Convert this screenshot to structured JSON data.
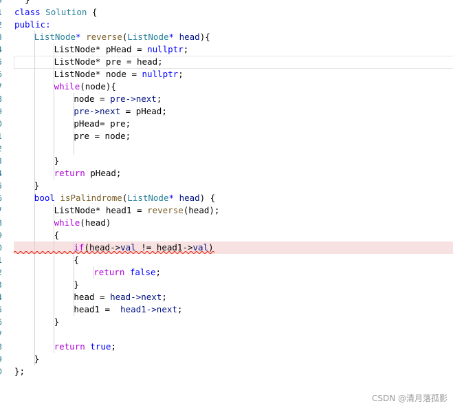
{
  "editor": {
    "lines": [
      {
        "num": "9",
        "indent": 0,
        "tokens": [
          {
            "t": "  }",
            "c": "plain"
          }
        ]
      },
      {
        "num": "1",
        "indent": 0,
        "tokens": [
          {
            "t": "class",
            "c": "kw"
          },
          {
            "t": " ",
            "c": "plain"
          },
          {
            "t": "Solution",
            "c": "type"
          },
          {
            "t": " {",
            "c": "plain"
          }
        ]
      },
      {
        "num": "2",
        "indent": 0,
        "tokens": [
          {
            "t": "public:",
            "c": "kw"
          }
        ]
      },
      {
        "num": "3",
        "indent": 1,
        "tokens": [
          {
            "t": "ListNode",
            "c": "type"
          },
          {
            "t": "* ",
            "c": "kw"
          },
          {
            "t": "reverse",
            "c": "fn"
          },
          {
            "t": "(",
            "c": "plain"
          },
          {
            "t": "ListNode",
            "c": "type"
          },
          {
            "t": "* ",
            "c": "kw"
          },
          {
            "t": "head",
            "c": "var"
          },
          {
            "t": "){",
            "c": "plain"
          }
        ]
      },
      {
        "num": "4",
        "indent": 2,
        "tokens": [
          {
            "t": "ListNode* pHead = ",
            "c": "plain"
          },
          {
            "t": "nullptr",
            "c": "kw"
          },
          {
            "t": ";",
            "c": "plain"
          }
        ]
      },
      {
        "num": "5",
        "indent": 2,
        "current": true,
        "tokens": [
          {
            "t": "ListNode* pre = head;",
            "c": "plain"
          }
        ]
      },
      {
        "num": "6",
        "indent": 2,
        "tokens": [
          {
            "t": "ListNode* node = ",
            "c": "plain"
          },
          {
            "t": "nullptr",
            "c": "kw"
          },
          {
            "t": ";",
            "c": "plain"
          }
        ]
      },
      {
        "num": "7",
        "indent": 2,
        "tokens": [
          {
            "t": "while",
            "c": "ctrl"
          },
          {
            "t": "(node){",
            "c": "plain"
          }
        ]
      },
      {
        "num": "8",
        "indent": 3,
        "tokens": [
          {
            "t": "node = ",
            "c": "plain"
          },
          {
            "t": "pre->next",
            "c": "var"
          },
          {
            "t": ";",
            "c": "plain"
          }
        ]
      },
      {
        "num": "9",
        "indent": 3,
        "tokens": [
          {
            "t": "pre->next",
            "c": "var"
          },
          {
            "t": " = pHead;",
            "c": "plain"
          }
        ]
      },
      {
        "num": "0",
        "indent": 3,
        "tokens": [
          {
            "t": "pHead= pre;",
            "c": "plain"
          }
        ]
      },
      {
        "num": "1",
        "indent": 3,
        "tokens": [
          {
            "t": "pre = node;",
            "c": "plain"
          }
        ]
      },
      {
        "num": "2",
        "indent": 3,
        "tokens": []
      },
      {
        "num": "3",
        "indent": 2,
        "tokens": [
          {
            "t": "}",
            "c": "plain"
          }
        ]
      },
      {
        "num": "4",
        "indent": 2,
        "tokens": [
          {
            "t": "return",
            "c": "ctrl"
          },
          {
            "t": " pHead;",
            "c": "plain"
          }
        ]
      },
      {
        "num": "5",
        "indent": 1,
        "tokens": [
          {
            "t": "}",
            "c": "plain"
          }
        ]
      },
      {
        "num": "6",
        "indent": 1,
        "tokens": [
          {
            "t": "bool",
            "c": "kw"
          },
          {
            "t": " ",
            "c": "plain"
          },
          {
            "t": "isPalindrome",
            "c": "fn"
          },
          {
            "t": "(",
            "c": "plain"
          },
          {
            "t": "ListNode",
            "c": "type"
          },
          {
            "t": "* ",
            "c": "kw"
          },
          {
            "t": "head",
            "c": "var"
          },
          {
            "t": ") {",
            "c": "plain"
          }
        ]
      },
      {
        "num": "7",
        "indent": 2,
        "tokens": [
          {
            "t": "ListNode* head1 = ",
            "c": "plain"
          },
          {
            "t": "reverse",
            "c": "fn"
          },
          {
            "t": "(head);",
            "c": "plain"
          }
        ]
      },
      {
        "num": "8",
        "indent": 2,
        "tokens": [
          {
            "t": "while",
            "c": "ctrl"
          },
          {
            "t": "(head)",
            "c": "plain"
          }
        ]
      },
      {
        "num": "9",
        "indent": 2,
        "tokens": [
          {
            "t": "{",
            "c": "plain"
          }
        ]
      },
      {
        "num": "0",
        "indent": 3,
        "error": true,
        "tokens": [
          {
            "t": "if",
            "c": "ctrl"
          },
          {
            "t": "(head->",
            "c": "plain"
          },
          {
            "t": "val",
            "c": "var"
          },
          {
            "t": " != head1->",
            "c": "plain"
          },
          {
            "t": "val",
            "c": "var"
          },
          {
            "t": ")",
            "c": "plain"
          }
        ]
      },
      {
        "num": "1",
        "indent": 3,
        "tokens": [
          {
            "t": "{",
            "c": "plain"
          }
        ]
      },
      {
        "num": "2",
        "indent": 4,
        "tokens": [
          {
            "t": "return",
            "c": "ctrl"
          },
          {
            "t": " ",
            "c": "plain"
          },
          {
            "t": "false",
            "c": "kw"
          },
          {
            "t": ";",
            "c": "plain"
          }
        ]
      },
      {
        "num": "3",
        "indent": 3,
        "tokens": [
          {
            "t": "}",
            "c": "plain"
          }
        ]
      },
      {
        "num": "4",
        "indent": 3,
        "tokens": [
          {
            "t": "head = ",
            "c": "plain"
          },
          {
            "t": "head->next",
            "c": "var"
          },
          {
            "t": ";",
            "c": "plain"
          }
        ]
      },
      {
        "num": "5",
        "indent": 3,
        "tokens": [
          {
            "t": "head1 =  ",
            "c": "plain"
          },
          {
            "t": "head1->next",
            "c": "var"
          },
          {
            "t": ";",
            "c": "plain"
          }
        ]
      },
      {
        "num": "6",
        "indent": 2,
        "tokens": [
          {
            "t": "}",
            "c": "plain"
          }
        ]
      },
      {
        "num": "7",
        "indent": 2,
        "tokens": []
      },
      {
        "num": "8",
        "indent": 2,
        "tokens": [
          {
            "t": "return",
            "c": "ctrl"
          },
          {
            "t": " ",
            "c": "plain"
          },
          {
            "t": "true",
            "c": "kw"
          },
          {
            "t": ";",
            "c": "plain"
          }
        ]
      },
      {
        "num": "9",
        "indent": 1,
        "tokens": [
          {
            "t": "}",
            "c": "plain"
          }
        ]
      },
      {
        "num": "0",
        "indent": 0,
        "tokens": [
          {
            "t": "};",
            "c": "plain"
          }
        ]
      }
    ]
  },
  "watermark": "CSDN @清月落孤影",
  "colors": {
    "keyword": "#0000ff",
    "type": "#267f99",
    "function": "#795e26",
    "variable": "#001080",
    "control": "#af00db",
    "line_number": "#237893",
    "error_highlight": "#f8e1e1",
    "error_squiggle": "#e51400"
  }
}
